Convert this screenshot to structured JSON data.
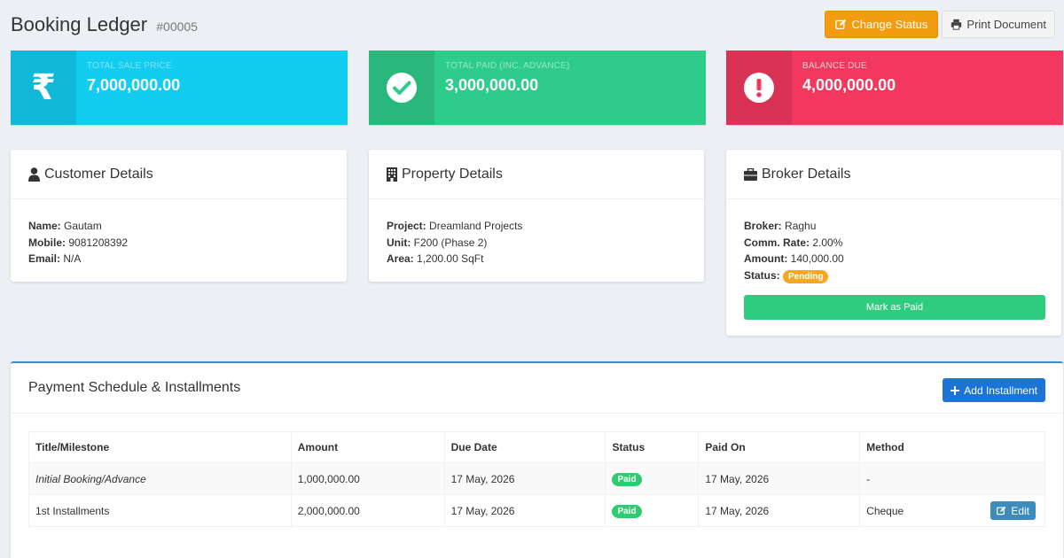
{
  "header": {
    "title": "Booking Ledger",
    "ref": "#00005",
    "change_status_label": "Change Status",
    "print_label": "Print Document"
  },
  "stats": [
    {
      "label": "TOTAL SALE PRICE",
      "value": "7,000,000.00",
      "icon": "rupee-icon",
      "color": "#13cdf0"
    },
    {
      "label": "TOTAL PAID (INC. ADVANCE)",
      "value": "3,000,000.00",
      "icon": "check-circle-icon",
      "color": "#2ecc8a"
    },
    {
      "label": "BALANCE DUE",
      "value": "4,000,000.00",
      "icon": "exclamation-circle-icon",
      "color": "#f3385f"
    }
  ],
  "customer": {
    "title": "Customer Details",
    "name_label": "Name:",
    "name": "Gautam",
    "mobile_label": "Mobile:",
    "mobile": "9081208392",
    "email_label": "Email:",
    "email": "N/A"
  },
  "property": {
    "title": "Property Details",
    "project_label": "Project:",
    "project": "Dreamland Projects",
    "unit_label": "Unit:",
    "unit": "F200 (Phase 2)",
    "area_label": "Area:",
    "area": "1,200.00 SqFt"
  },
  "broker": {
    "title": "Broker Details",
    "broker_label": "Broker:",
    "broker": "Raghu",
    "rate_label": "Comm. Rate:",
    "rate": "2.00%",
    "amount_label": "Amount:",
    "amount": "140,000.00",
    "status_label": "Status:",
    "status": "Pending",
    "mark_paid_label": "Mark as Paid"
  },
  "schedule": {
    "title": "Payment Schedule & Installments",
    "add_label": "Add Installment",
    "columns": [
      "Title/Milestone",
      "Amount",
      "Due Date",
      "Status",
      "Paid On",
      "Method"
    ],
    "rows": [
      {
        "title": "Initial Booking/Advance",
        "amount": "1,000,000.00",
        "due": "17 May, 2026",
        "status": "Paid",
        "paid_on": "17 May, 2026",
        "method": "-"
      },
      {
        "title": "1st Installments",
        "amount": "2,000,000.00",
        "due": "17 May, 2026",
        "status": "Paid",
        "paid_on": "17 May, 2026",
        "method": "Cheque",
        "action": "Edit"
      }
    ]
  }
}
